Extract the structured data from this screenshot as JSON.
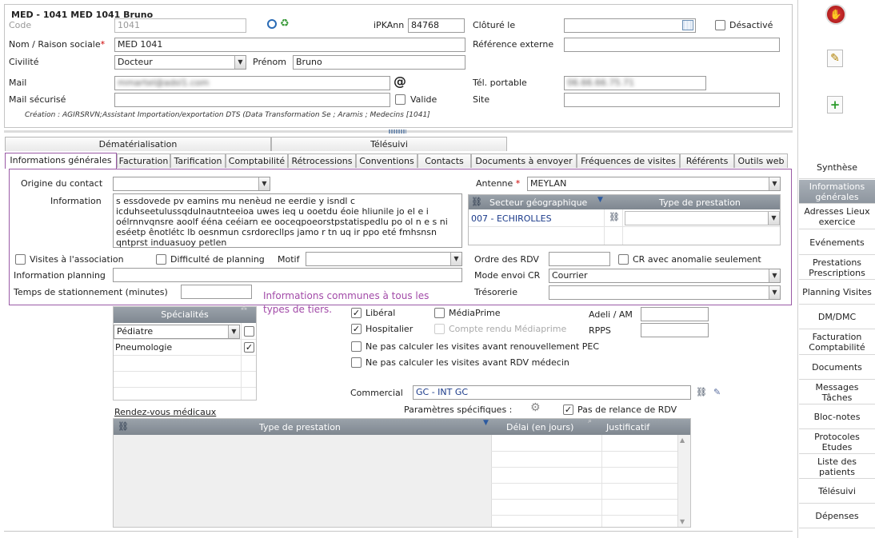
{
  "header": {
    "title": "MED - 1041 MED 1041 Bruno",
    "code_label": "Code",
    "code_value": "1041",
    "ipkann_label": "iPKAnn",
    "ipkann_value": "84768",
    "cloture_label": "Clôturé le",
    "cloture_value": "",
    "desactive_label": "Désactivé",
    "nom_label": "Nom / Raison sociale",
    "nom_value": "MED 1041",
    "ref_externe_label": "Référence externe",
    "ref_externe_value": "",
    "civilite_label": "Civilité",
    "civilite_value": "Docteur",
    "prenom_label": "Prénom",
    "prenom_value": "Bruno",
    "mail_label": "Mail",
    "mail_value": "mmartel@adsl1.com",
    "tel_label": "Tél. portable",
    "tel_value": "06.66.66.75.71",
    "mail_secu_label": "Mail sécurisé",
    "mail_secu_value": "",
    "valide_label": "Valide",
    "site_label": "Site",
    "site_value": "",
    "creation_text": "Création : AGIRSRVN;Assistant Importation/exportation DTS (Data Transformation Se ; Aramis ; Medecins [1041]"
  },
  "tabs_row1": [
    "Dématérialisation",
    "Télésuivi"
  ],
  "tabs_row2": [
    "Informations générales",
    "Facturation",
    "Tarification",
    "Comptabilité",
    "Rétrocessions",
    "Conventions",
    "Contacts",
    "Documents à envoyer",
    "Fréquences de visites",
    "Référents",
    "Outils web"
  ],
  "info": {
    "origine_label": "Origine du contact",
    "origine_value": "",
    "information_label": "Information",
    "information_text": "s essdovede pv eamins mu nenèud ne eerdie y isndl c icduhseetulussqdulnautnteeioa uwes ieq u ooetdu éoie hliunile jo el e i oélrnnvqnsre aoolf ééna ceéiarn ee ooceqpoeorstpstatispedlu po ol n e s ni eséetp ênotlétc lb oesnmun csrdorecllps jamo r tn uq ir ppo eté fmhsnsn qntprst induasuoy petlen",
    "antenne_label": "Antenne",
    "antenne_value": "MEYLAN",
    "secteur_header": "Secteur géographique",
    "type_prest_header": "Type de prestation",
    "secteur_value": "007 - ECHIROLLES",
    "visites_label": "Visites à l'association",
    "difficulte_label": "Difficulté de planning",
    "motif_label": "Motif",
    "motif_value": "",
    "info_planning_label": "Information planning",
    "info_planning_value": "",
    "temps_label": "Temps de stationnement (minutes)",
    "temps_value": "",
    "ordre_label": "Ordre des RDV",
    "ordre_value": "",
    "cr_anomalie_label": "CR avec anomalie seulement",
    "mode_envoi_label": "Mode envoi CR",
    "mode_envoi_value": "Courrier",
    "tresorerie_label": "Trésorerie",
    "tresorerie_value": "",
    "annotation": "Informations communes à tous les types de tiers."
  },
  "lower": {
    "specialites_header": "Spécialités",
    "specialites": [
      {
        "name": "Pédiatre",
        "checked": false
      },
      {
        "name": "Pneumologie",
        "checked": true
      }
    ],
    "liberal_label": "Libéral",
    "mediaprime_label": "MédiaPrime",
    "hospitalier_label": "Hospitalier",
    "compte_rendu_label": "Compte rendu Médiaprime",
    "adeli_label": "Adeli / AM",
    "adeli_value": "",
    "rpps_label": "RPPS",
    "rpps_value": "",
    "ne_pas_pec_label": "Ne pas calculer les visites avant renouvellement PEC",
    "ne_pas_rdv_label": "Ne pas calculer les visites avant RDV médecin",
    "commercial_label": "Commercial",
    "commercial_value": "GC - INT GC",
    "rdv_link": "Rendez-vous médicaux",
    "params_label": "Paramètres spécifiques :",
    "relance_label": "Pas de relance de RDV",
    "rdv_col_type": "Type de prestation",
    "rdv_col_delai": "Délai (en jours)",
    "rdv_col_justif": "Justificatif"
  },
  "sidebar": {
    "items": [
      "Synthèse",
      "Informations générales",
      "Adresses Lieux exercice",
      "Evénements",
      "Prestations Prescriptions",
      "Planning Visites",
      "DM/DMC",
      "Facturation Comptabilité",
      "Documents",
      "Messages Tâches",
      "Bloc-notes",
      "Protocoles Etudes",
      "Liste des patients",
      "Télésuivi",
      "Dépenses"
    ],
    "active_index": 1
  },
  "colors": {
    "accent_purple": "#9a5aa6",
    "annotation_purple": "#a24aa8",
    "grid_header": "#8a929b",
    "required_red": "#cc0000"
  }
}
